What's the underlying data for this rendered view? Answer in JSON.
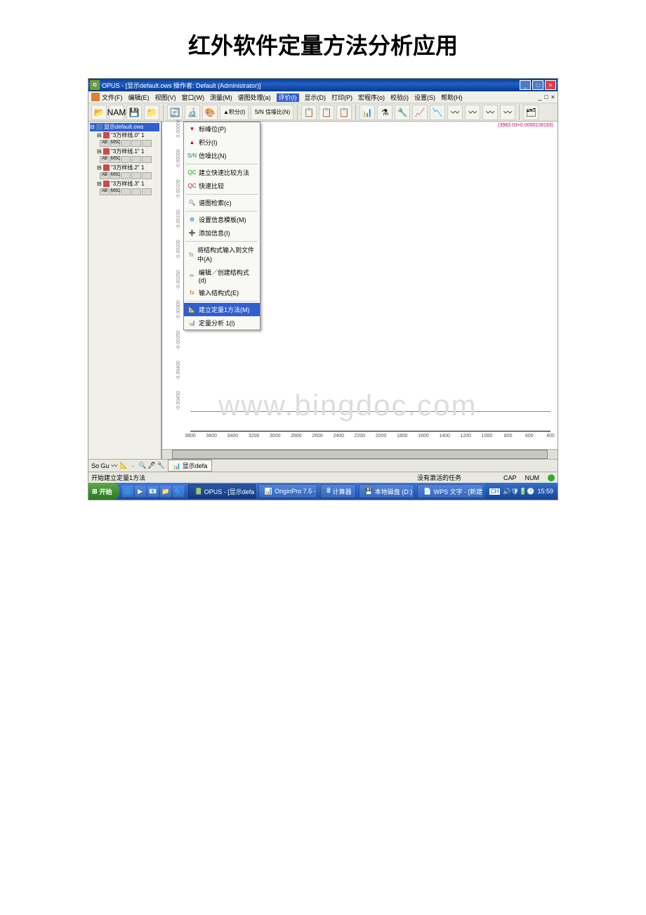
{
  "doc_title": "红外软件定量方法分析应用",
  "window": {
    "title": "OPUS - [显示default.ows    操作者: Default  (Administrator)]",
    "min": "_",
    "max": "□",
    "close": "×",
    "doc_min": "_",
    "doc_max": "□",
    "doc_close": "×"
  },
  "menu": {
    "items": [
      "文件(F)",
      "编辑(E)",
      "视图(V)",
      "窗口(W)",
      "测量(M)",
      "谱图处理(a)",
      "评价(l)",
      "显示(D)",
      "打印(P)",
      "宏程序(o)",
      "校验(i)",
      "设置(S)",
      "帮助(H)"
    ],
    "active_index": 6
  },
  "toolbar_icons": [
    "📂",
    "NAM",
    "💾",
    "📁",
    "|",
    "🔄",
    "🔬",
    "🎨",
    "▲积分(I)",
    "S/N 信噪比(N)",
    "|",
    "📋",
    "📋",
    "📋",
    "|",
    "📊",
    "⚗",
    "🔧",
    "📈",
    "📉",
    "〰",
    "〰",
    "〰",
    "〰",
    "|",
    "🗂"
  ],
  "submenu": {
    "items": [
      {
        "ico": "▼",
        "label": "标峰位(P)",
        "color": "#c04"
      },
      {
        "ico": "▲",
        "label": "积分(I)",
        "color": "#c04"
      },
      {
        "ico": "S/N",
        "label": "信噪比(N)",
        "color": "#088"
      },
      {
        "sep": true
      },
      {
        "ico": "QC",
        "label": "建立快速比较方法",
        "color": "#0a0"
      },
      {
        "ico": "QC",
        "label": "快速比较",
        "color": "#c04"
      },
      {
        "sep": true
      },
      {
        "ico": "🔍",
        "label": "谱图检索(c)",
        "color": "#c60"
      },
      {
        "sep": true
      },
      {
        "ico": "⚙",
        "label": "设置信息模板(M)",
        "color": "#06c"
      },
      {
        "ico": "➕",
        "label": "添加信息(I)",
        "color": "#c04"
      },
      {
        "sep": true
      },
      {
        "ico": "fx",
        "label": "将结构式输入到文件中(A)",
        "color": "#c60"
      },
      {
        "ico": "✏",
        "label": "编辑／创建结构式(d)",
        "color": "#c60"
      },
      {
        "ico": "fx",
        "label": "输入结构式(E)",
        "color": "#c60"
      },
      {
        "sep": true
      },
      {
        "ico": "📐",
        "label": "建立定量1方法(M)",
        "color": "#c60",
        "sel": true
      },
      {
        "ico": "📊",
        "label": "定量分析 1(l)",
        "color": "#c60"
      }
    ]
  },
  "tree": [
    {
      "label": "显示default.ows",
      "type": "ws",
      "sel": true
    },
    {
      "label": "\"3万样线.0\" 1",
      "type": "sp",
      "sub": true
    },
    {
      "label": "\"3万样线.1\" 1",
      "type": "sp",
      "sub": true
    },
    {
      "label": "\"3万样线.2\" 1",
      "type": "sp",
      "sub": true
    },
    {
      "label": "\"3万样线.3\" 1",
      "type": "sp",
      "sub": true
    }
  ],
  "yaxis_ticks": [
    "0.00000",
    "-0.00050",
    "-0.00100",
    "-0.00150",
    "-0.00200",
    "-0.00250",
    "-0.00300",
    "-0.00350",
    "-0.00400",
    "-0.00450"
  ],
  "xaxis_ticks": [
    "3800",
    "3600",
    "3400",
    "3200",
    "3000",
    "2800",
    "2600",
    "2400",
    "2200",
    "2000",
    "1800",
    "1600",
    "1400",
    "1200",
    "1000",
    "800",
    "600",
    "400"
  ],
  "coord_readout": "(3983.03×0.0000228193)",
  "watermark": "www.bingdoc.com",
  "bottom_tab": "显示defa",
  "bottom_icons": [
    "So",
    "Gu",
    "〰",
    "📐",
    "·",
    "🔍",
    "🖊",
    "🔧"
  ],
  "status": {
    "left": "开始建立定量1方法",
    "center": "没有激活的任务",
    "right": [
      "CAP",
      "NUM",
      ""
    ]
  },
  "taskbar": {
    "start": "开始",
    "quick": [
      "🌐",
      "▶",
      "📧",
      "📁",
      "🔷"
    ],
    "tasks": [
      {
        "ico": "📗",
        "label": "OPUS - [显示defa",
        "active": true
      },
      {
        "ico": "📊",
        "label": "OriginPro 7.5 -"
      },
      {
        "ico": "🖩",
        "label": "计算器"
      },
      {
        "ico": "💾",
        "label": "本地磁盘 (D:)"
      },
      {
        "ico": "📄",
        "label": "WPS 文字 - [新建"
      }
    ],
    "tray": {
      "lang": "CH",
      "icons": [
        "🔊",
        "🛡",
        "🔋",
        "🕐"
      ],
      "time": "15:59"
    }
  }
}
